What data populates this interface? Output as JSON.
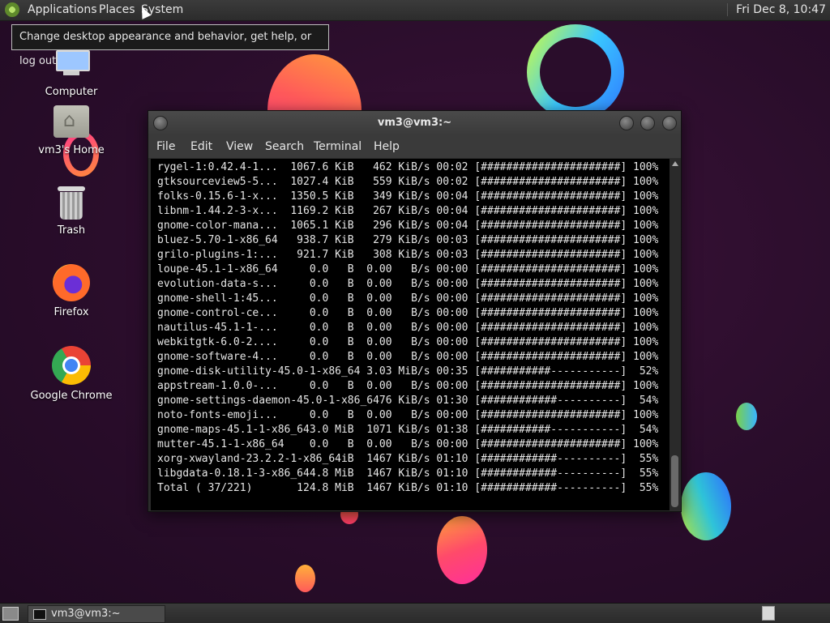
{
  "top_panel": {
    "menus": [
      "Applications",
      "Places",
      "System"
    ],
    "clock": "Fri Dec  8, 10:47"
  },
  "tooltip": "Change desktop appearance and behavior, get help, or log out",
  "desktop_icons": [
    {
      "label": "Computer",
      "icon": "computer-icon"
    },
    {
      "label": "vm3's Home",
      "icon": "home-folder-icon"
    },
    {
      "label": "Trash",
      "icon": "trash-icon"
    },
    {
      "label": "Firefox",
      "icon": "firefox-icon"
    },
    {
      "label": "Google Chrome",
      "icon": "chrome-icon"
    }
  ],
  "terminal": {
    "title": "vm3@vm3:~",
    "menu": [
      "File",
      "Edit",
      "View",
      "Search",
      "Terminal",
      "Help"
    ],
    "lines": [
      "rygel-1:0.42.4-1...  1067.6 KiB   462 KiB/s 00:02 [######################] 100%",
      "gtksourceview5-5...  1027.4 KiB   559 KiB/s 00:02 [######################] 100%",
      "folks-0.15.6-1-x...  1350.5 KiB   349 KiB/s 00:04 [######################] 100%",
      "libnm-1.44.2-3-x...  1169.2 KiB   267 KiB/s 00:04 [######################] 100%",
      "gnome-color-mana...  1065.1 KiB   296 KiB/s 00:04 [######################] 100%",
      "bluez-5.70-1-x86_64   938.7 KiB   279 KiB/s 00:03 [######################] 100%",
      "grilo-plugins-1:...   921.7 KiB   308 KiB/s 00:03 [######################] 100%",
      "loupe-45.1-1-x86_64     0.0   B  0.00   B/s 00:00 [######################] 100%",
      "evolution-data-s...     0.0   B  0.00   B/s 00:00 [######################] 100%",
      "gnome-shell-1:45...     0.0   B  0.00   B/s 00:00 [######################] 100%",
      "gnome-control-ce...     0.0   B  0.00   B/s 00:00 [######################] 100%",
      "nautilus-45.1-1-...     0.0   B  0.00   B/s 00:00 [######################] 100%",
      "webkitgtk-6.0-2....     0.0   B  0.00   B/s 00:00 [######################] 100%",
      "gnome-software-4...     0.0   B  0.00   B/s 00:00 [######################] 100%",
      "gnome-disk-utility-45.0-1-x86_64 3.03 MiB/s 00:35 [###########-----------]  52%",
      "appstream-1.0.0-...     0.0   B  0.00   B/s 00:00 [######################] 100%",
      "gnome-settings-daemon-45.0-1-x86_6476 KiB/s 01:30 [############----------]  54%",
      "noto-fonts-emoji...     0.0   B  0.00   B/s 00:00 [######################] 100%",
      "gnome-maps-45.1-1-x86_643.0 MiB  1071 KiB/s 01:38 [###########-----------]  54%",
      "mutter-45.1-1-x86_64    0.0   B  0.00   B/s 00:00 [######################] 100%",
      "xorg-xwayland-23.2.2-1-x86_64iB  1467 KiB/s 01:10 [############----------]  55%",
      "libgdata-0.18.1-3-x86_644.8 MiB  1467 KiB/s 01:10 [############----------]  55%",
      "Total ( 37/221)       124.8 MiB  1467 KiB/s 01:10 [############----------]  55%"
    ]
  },
  "bottom_panel": {
    "task": "vm3@vm3:~"
  }
}
